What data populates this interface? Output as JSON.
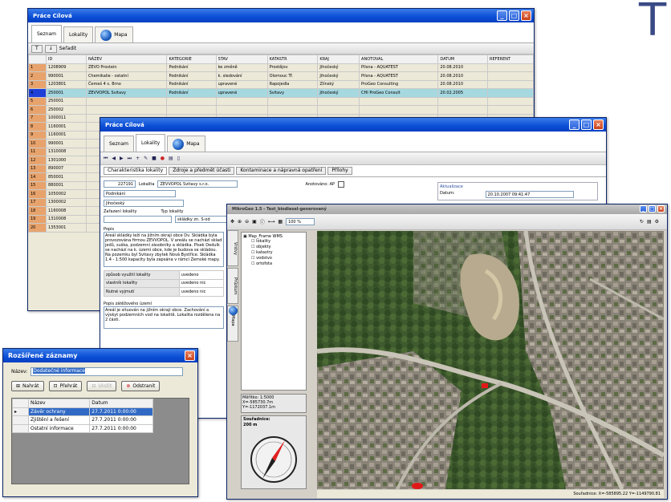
{
  "big_letter": "T",
  "win1": {
    "title": "Práce Cílová",
    "tabs": [
      "Seznam",
      "Lokality",
      "Mapa"
    ],
    "toolbar": [
      "T",
      "↓",
      "Seřadit"
    ],
    "columns": [
      "ID",
      "NÁZEV",
      "KATEGORIE",
      "STAV",
      "KATASTR",
      "KRAJ",
      "ANOTOVAL",
      "DATUM",
      "REFERENT"
    ],
    "rows": [
      [
        "1",
        "1208909",
        "ZEVO Prostein",
        "Podnikání",
        "ke změně",
        "Prostějov",
        "Jihočeský",
        "Pilsna - AQUATEST",
        "20.08.2010",
        ""
      ],
      [
        "2",
        "990001",
        "Chemikalie - ostatní",
        "Podnikání",
        "k. sledování",
        "Olomouc Tř.",
        "Jihočeský",
        "Pilsna - AQUATEST",
        "20.08.2010",
        ""
      ],
      [
        "3",
        "1203801",
        "Čemeš 4 s. Brno",
        "Podnikání",
        "upravené",
        "Rapojedla",
        "Zlínský",
        "ProGeo Consulting",
        "20.08.2010",
        ""
      ],
      [
        "4",
        "250001",
        "ZEVVOPOL Svitavy",
        "Podnikání",
        "upravené",
        "Svitavy",
        "Jihočeský",
        "CHI ProGeo Consult",
        "20.02.2005",
        ""
      ],
      [
        "5",
        "250001",
        "",
        "",
        "",
        "",
        "",
        "",
        "",
        ""
      ],
      [
        "6",
        "250002",
        "",
        "",
        "",
        "",
        "",
        "",
        "",
        ""
      ],
      [
        "7",
        "1000011",
        "",
        "",
        "",
        "",
        "",
        "",
        "",
        ""
      ],
      [
        "8",
        "1160001",
        "",
        "",
        "",
        "",
        "",
        "",
        "",
        ""
      ],
      [
        "9",
        "1160001",
        "",
        "",
        "",
        "",
        "",
        "",
        "",
        ""
      ],
      [
        "10",
        "990001",
        "",
        "",
        "",
        "",
        "",
        "",
        "",
        ""
      ],
      [
        "11",
        "1310008",
        "",
        "",
        "",
        "",
        "",
        "",
        "",
        ""
      ],
      [
        "12",
        "1301000",
        "",
        "",
        "",
        "",
        "",
        "",
        "",
        ""
      ],
      [
        "13",
        "890007",
        "",
        "",
        "",
        "",
        "",
        "",
        "",
        ""
      ],
      [
        "14",
        "850001",
        "",
        "",
        "",
        "",
        "",
        "",
        "",
        ""
      ],
      [
        "15",
        "880001",
        "",
        "",
        "",
        "",
        "",
        "",
        "",
        ""
      ],
      [
        "16",
        "1050002",
        "",
        "",
        "",
        "",
        "",
        "",
        "",
        ""
      ],
      [
        "17",
        "1300002",
        "",
        "",
        "",
        "",
        "",
        "",
        "",
        ""
      ],
      [
        "18",
        "1160008",
        "",
        "",
        "",
        "",
        "",
        "",
        "",
        ""
      ],
      [
        "19",
        "1310008",
        "",
        "",
        "",
        "",
        "",
        "",
        "",
        ""
      ],
      [
        "20",
        "1353001",
        "",
        "",
        "",
        "",
        "",
        "",
        "",
        ""
      ]
    ]
  },
  "win2": {
    "title": "Práce Cílová",
    "tabs": [
      "Seznam",
      "Lokality",
      "Mapa"
    ],
    "subtabs": [
      "Charakteristika lokality",
      "Zdroje a předmět účasti",
      "Kontaminace a nápravná opatření",
      "Přílohy"
    ],
    "id_value": "227191",
    "lokalita_label": "Lokalita",
    "lokalita_value": "ZEVVOPOL Svitavy s.r.o.",
    "kraj_value": "Jihočeský",
    "kategorie_value": "Podnikání",
    "anot_label": "Anotováno: AP",
    "actualizace_label": "Aktualizace",
    "datum_label": "Datum:",
    "datum_value": "20.10.2007 09:41:47",
    "zarazeni_label": "Zařazení lokality",
    "typ_label": "Typ lokality",
    "typ_value": "skládky zn. S-od",
    "popis_label": "Popis",
    "popis_text": "Areál skládky leží na jižním okraji obce Dv. Skládka byla provozována firmou ZEVVOPOL. V areálu se nachází sklad jedů, suška, podzemní zásobníky a skládka. Písek Dedulk se nachází na k. území obce, kde je budova se skládou. Na pozemku byl Svitavy zbytek Nová Bystřice. Skládka 1.4 - 1:500 kapacity byla zapsána v rámci Zemské mapy.",
    "vypis_rows": [
      "způsob využití lokality",
      "vlastník lokality",
      "Nutné vyjmutí"
    ],
    "vypis_values": [
      "uvedeno",
      "uvedeno nic",
      "uvedeno nic"
    ],
    "popis_sanace_label": "Popis zátěžového území",
    "popis_sanace_text": "Areál je situován na jižním okraji obce. Zachování a výskyt podzemních vod na lokalitě. Lokalita rozdělena na 2 části."
  },
  "win3": {
    "title": "MikroGeo 1.5 - Test_biodiesel-generovaný",
    "side_tabs": [
      "Vrstvy",
      "Průzkum",
      "Mapa"
    ],
    "tree_root": "Map_Frame WMS",
    "tree_items": [
      "lokality",
      "objekty",
      "katastry",
      "vodstvo",
      "ortofota"
    ],
    "coords_label": "Měřítko: 1:5000",
    "coords_x": "X=-585730.7m",
    "coords_y": "Y=-1172037.1m",
    "scale_label": "Souřadnice:",
    "scale_value": "200 m",
    "zoom_value": "100 %",
    "status_text": "Souřadnice: X=-585895.22 Y=-1149790.81"
  },
  "win4": {
    "title": "Rozšířené záznamy",
    "nazev_label": "Název:",
    "nazev_value": "Dodatečné informace",
    "buttons": [
      "Nahrát",
      "Přehrát",
      "Uložit",
      "Odstranit"
    ],
    "columns": [
      "Název",
      "Datum"
    ],
    "rows": [
      [
        "Závěr ochrany",
        "27.7.2011 0:00:00"
      ],
      [
        "Zjištění a řešení",
        "27.7.2011 0:00:00"
      ],
      [
        "Ostatní informace",
        "27.7.2011 0:00:00"
      ]
    ]
  },
  "colors": {
    "titlebar": "#0a4ed6",
    "selection": "#1e40d8",
    "row_head": "#e8a36c"
  }
}
